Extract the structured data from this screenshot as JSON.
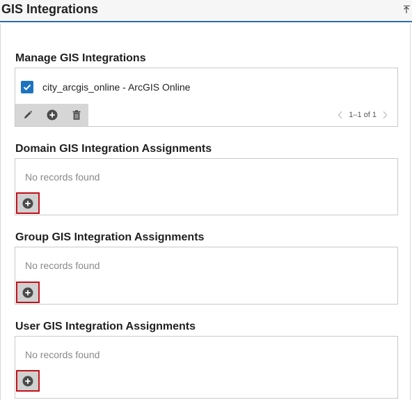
{
  "header": {
    "title": "GIS Integrations"
  },
  "manage": {
    "title": "Manage GIS Integrations",
    "items": [
      {
        "label": "city_arcgis_online - ArcGIS Online",
        "checked": true
      }
    ],
    "pagination": "1–1 of 1"
  },
  "domain": {
    "title": "Domain GIS Integration Assignments",
    "empty_text": "No records found"
  },
  "group": {
    "title": "Group GIS Integration Assignments",
    "empty_text": "No records found"
  },
  "user": {
    "title": "User GIS Integration Assignments",
    "empty_text": "No records found"
  },
  "colors": {
    "accent": "#1e73be",
    "header_rule": "#2e6da4",
    "highlight": "#c0111a"
  },
  "icons": [
    "collapse-top-icon",
    "check-icon",
    "pencil-icon",
    "plus-circle-icon",
    "trash-icon",
    "chevron-left-icon",
    "chevron-right-icon"
  ]
}
